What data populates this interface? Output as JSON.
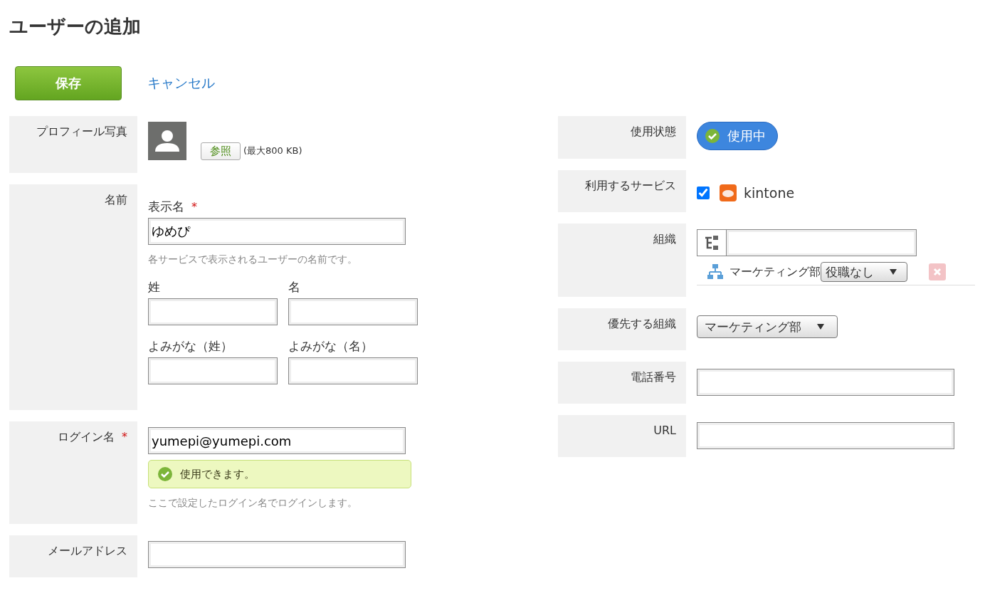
{
  "title": "ユーザーの追加",
  "actions": {
    "save": "保存",
    "cancel": "キャンセル"
  },
  "left": {
    "profile": {
      "label": "プロフィール写真",
      "browse": "参照",
      "limit": "(最大800 KB)"
    },
    "name": {
      "label": "名前",
      "display_name": {
        "label": "表示名",
        "required_mark": "*",
        "value": "ゆめぴ",
        "hint": "各サービスで表示されるユーザーの名前です。"
      },
      "fields": [
        {
          "label": "姓"
        },
        {
          "label": "名"
        },
        {
          "label": "よみがな（姓）"
        },
        {
          "label": "よみがな（名）"
        }
      ]
    },
    "login": {
      "label": "ログイン名",
      "required_mark": "*",
      "value": "yumepi@yumepi.com",
      "message": "使用できます。",
      "hint": "ここで設定したログイン名でログインします。"
    },
    "email": {
      "label": "メールアドレス"
    }
  },
  "right": {
    "status": {
      "label": "使用状態",
      "text": "使用中",
      "active": true
    },
    "services": {
      "label": "利用するサービス",
      "items": [
        {
          "name": "kintone",
          "checked": true
        }
      ]
    },
    "organization": {
      "label": "組織",
      "items": [
        {
          "name": "マーケティング部",
          "role": "役職なし"
        }
      ]
    },
    "primary_org": {
      "label": "優先する組織",
      "value": "マーケティング部"
    },
    "phone": {
      "label": "電話番号"
    },
    "url": {
      "label": "URL"
    }
  }
}
